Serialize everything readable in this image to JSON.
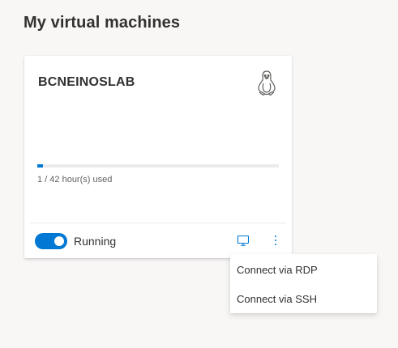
{
  "page": {
    "title": "My virtual machines"
  },
  "vm_card": {
    "name": "BCNEINOSLAB",
    "os_icon": "linux-tux-icon",
    "usage": {
      "used_hours": 1,
      "quota_hours": 42,
      "fraction": 0.024,
      "label": "1 / 42 hour(s) used"
    },
    "state": {
      "label": "Running",
      "toggle_on": true
    },
    "actions": {
      "connect_icon": "monitor-icon",
      "more_icon": "more-vertical-icon"
    }
  },
  "context_menu": {
    "items": [
      {
        "label": "Connect via RDP"
      },
      {
        "label": "Connect via SSH"
      }
    ]
  },
  "colors": {
    "background": "#f8f7f6",
    "card": "#ffffff",
    "accent": "#0078d4",
    "text_primary": "#323130",
    "text_secondary": "#605e5c",
    "track": "#edebe9"
  }
}
